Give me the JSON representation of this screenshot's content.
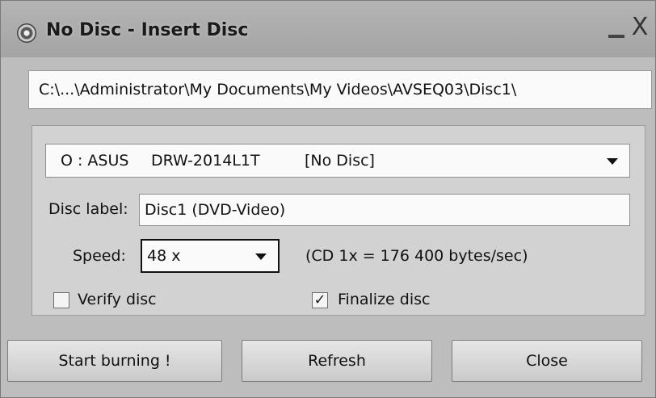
{
  "window": {
    "title": "No Disc - Insert Disc",
    "close_glyph": "X"
  },
  "path": "C:\\...\\Administrator\\My Documents\\My Videos\\AVSEQ03\\Disc1\\",
  "drive": {
    "letter": "O : ASUS",
    "model": "DRW-2014L1T",
    "status": "[No Disc]"
  },
  "disc_label": {
    "label": "Disc label:",
    "value": "Disc1 (DVD-Video)"
  },
  "speed": {
    "label": "Speed:",
    "value": "48 x",
    "note": "(CD 1x = 176 400 bytes/sec)"
  },
  "options": {
    "verify_label": "Verify disc",
    "verify_checked": false,
    "finalize_label": "Finalize disc",
    "finalize_checked": true,
    "check_glyph": "✓"
  },
  "buttons": {
    "start": "Start burning !",
    "refresh": "Refresh",
    "close": "Close"
  },
  "icons": {
    "title": "disc-icon",
    "minimize": "minimize-icon",
    "close": "close-icon",
    "dropdown": "chevron-down-icon"
  }
}
